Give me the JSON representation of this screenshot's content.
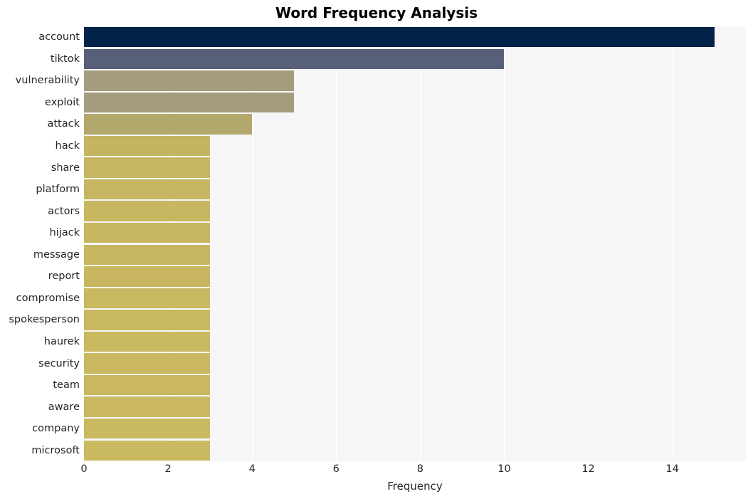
{
  "chart_data": {
    "type": "bar",
    "orientation": "horizontal",
    "title": "Word Frequency Analysis",
    "xlabel": "Frequency",
    "ylabel": "",
    "categories": [
      "account",
      "tiktok",
      "vulnerability",
      "exploit",
      "attack",
      "hack",
      "share",
      "platform",
      "actors",
      "hijack",
      "message",
      "report",
      "compromise",
      "spokesperson",
      "haurek",
      "security",
      "team",
      "aware",
      "company",
      "microsoft"
    ],
    "values": [
      15,
      10,
      5,
      5,
      4,
      3,
      3,
      3,
      3,
      3,
      3,
      3,
      3,
      3,
      3,
      3,
      3,
      3,
      3,
      3
    ],
    "bar_colors": [
      "#042349",
      "#585f79",
      "#a39d7d",
      "#a39d7d",
      "#b3a86b",
      "#c5b563",
      "#c6b662",
      "#c6b662",
      "#c7b761",
      "#c7b761",
      "#c7b761",
      "#c8b760",
      "#c8b860",
      "#c8b860",
      "#c8b860",
      "#c9b85f",
      "#c9b85f",
      "#c9b85f",
      "#c9b95f",
      "#c9b95f"
    ],
    "xticks": [
      "0",
      "2",
      "4",
      "6",
      "8",
      "10",
      "12",
      "14"
    ],
    "xtick_values": [
      0,
      2,
      4,
      6,
      8,
      10,
      12,
      14
    ],
    "xlim": [
      0,
      15.75
    ],
    "grid": "vertical-only",
    "legend": "none",
    "plot_background": "#f6f6f7",
    "gridline_color": "#ffffff",
    "figure_background": "#ffffff",
    "title_color": "#000000",
    "tick_label_color": "#262626"
  }
}
